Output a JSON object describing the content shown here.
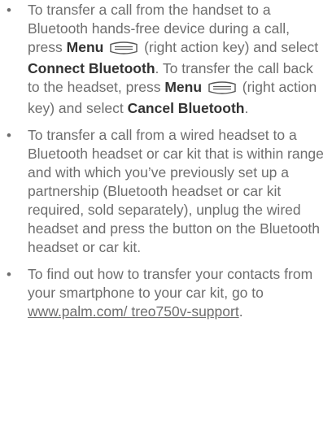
{
  "bullets": [
    {
      "text_1": "To transfer a call from the handset to a Bluetooth hands-free device during a call, press ",
      "menu_1": "Menu",
      "text_2": " (right action key) and select ",
      "connect": "Connect Bluetooth",
      "text_3": ". To transfer the call back to the headset, press ",
      "menu_2": "Menu",
      "text_4": " (right action key) and select ",
      "cancel": "Cancel Bluetooth",
      "text_5": "."
    },
    {
      "text": "To transfer a call from a wired headset to a Bluetooth headset or car kit that is within range and with which you’ve previously set up a partnership (Bluetooth headset or car kit required, sold separately), unplug the wired headset and press the button on the Bluetooth headset or car kit."
    },
    {
      "text_before": "To find out how to transfer your contacts from your smartphone to your car kit, go to ",
      "link": "www.palm.com/ treo750v-support",
      "text_after": "."
    }
  ],
  "bullet_glyph": "•",
  "icons": {
    "menu_key": "right-action-key-icon"
  }
}
